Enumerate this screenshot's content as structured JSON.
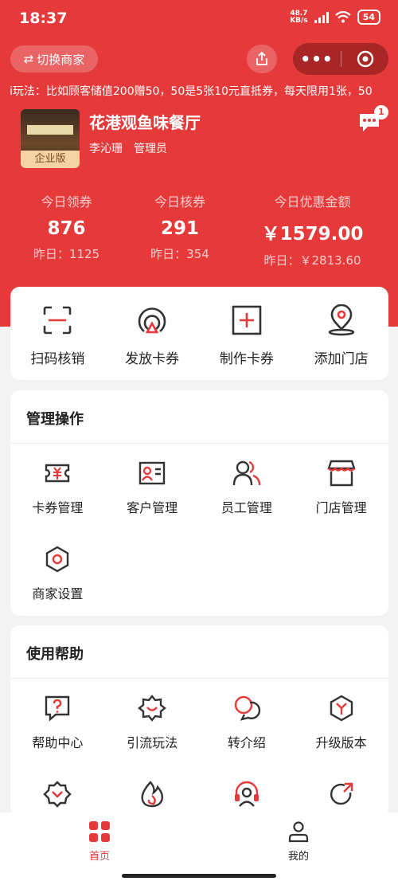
{
  "status": {
    "time": "18:37",
    "net_top": "48.7",
    "net_bottom": "KB/s",
    "battery": "54"
  },
  "topbar": {
    "switch_label": "切换商家"
  },
  "marquee": "i玩法：比如顾客储值200赠50，50是5张10元直抵券，每天限用1张，50",
  "merchant": {
    "name": "花港观鱼味餐厅",
    "user": "李沁珊",
    "role": "管理员",
    "badge": "企业版",
    "msg_count": "1"
  },
  "stats": [
    {
      "label": "今日领券",
      "value": "876",
      "yesterday": "昨日：1125"
    },
    {
      "label": "今日核券",
      "value": "291",
      "yesterday": "昨日：354"
    },
    {
      "label": "今日优惠金额",
      "value": "￥1579.00",
      "yesterday": "昨日：￥2813.60"
    }
  ],
  "quick": [
    {
      "label": "扫码核销",
      "icon": "scan-icon"
    },
    {
      "label": "发放卡券",
      "icon": "issue-coupon-icon"
    },
    {
      "label": "制作卡券",
      "icon": "add-box-icon"
    },
    {
      "label": "添加门店",
      "icon": "location-icon"
    }
  ],
  "manage": {
    "title": "管理操作",
    "items": [
      {
        "label": "卡券管理",
        "icon": "coupon-icon"
      },
      {
        "label": "客户管理",
        "icon": "customer-card-icon"
      },
      {
        "label": "员工管理",
        "icon": "staff-icon"
      },
      {
        "label": "门店管理",
        "icon": "store-icon"
      },
      {
        "label": "商家设置",
        "icon": "settings-hex-icon"
      }
    ]
  },
  "help": {
    "title": "使用帮助",
    "items": [
      {
        "label": "帮助中心",
        "icon": "help-icon"
      },
      {
        "label": "引流玩法",
        "icon": "smile-badge-icon"
      },
      {
        "label": "转介绍",
        "icon": "chat-bubbles-icon"
      },
      {
        "label": "升级版本",
        "icon": "upgrade-hex-icon"
      }
    ]
  },
  "nav": [
    {
      "label": "首页",
      "icon": "home-grid-icon"
    },
    {
      "label": "我的",
      "icon": "user-icon"
    }
  ],
  "colors": {
    "primary": "#e5393a",
    "capsule": "#a82726",
    "badge_gold": "#f3d3a2"
  }
}
